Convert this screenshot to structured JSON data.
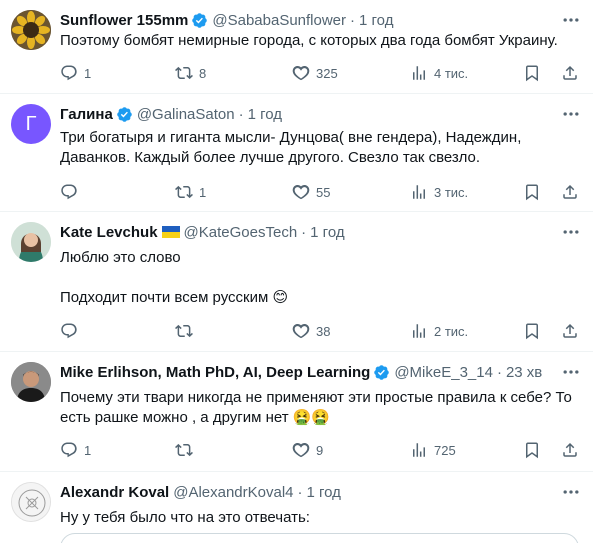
{
  "tweets": [
    {
      "name": "Sunflower 155mm",
      "verified": true,
      "handle": "@SababaSunflower",
      "time": "1 год",
      "text": [
        "Поэтому бомбят немирные города, с которых два года бомбят Украину."
      ],
      "replies": "1",
      "reposts": "8",
      "likes": "325",
      "views": "4 тис."
    },
    {
      "name": "Галина",
      "verified": true,
      "handle": "@GalinaSaton",
      "time": "1 год",
      "avatar_letter": "Г",
      "text": [
        "Три богатыря и гиганта мысли- Дунцова( вне гендера), Надеждин,",
        "Даванков. Каждый более лучше другого. Свезло так свезло."
      ],
      "replies": "",
      "reposts": "1",
      "likes": "55",
      "views": "3 тис."
    },
    {
      "name": "Kate Levchuk",
      "flag": "ukraine-flag",
      "handle": "@KateGoesTech",
      "time": "1 год",
      "text": [
        "Люблю это слово",
        "",
        "Подходит почти всем русским 😊"
      ],
      "replies": "",
      "reposts": "",
      "likes": "38",
      "views": "2 тис."
    },
    {
      "name": "Mike Erlihson, Math PhD, AI, Deep Learning",
      "verified": true,
      "handle": "@MikeE_3_14",
      "time": "23 хв",
      "text": [
        "Почему эти твари никогда не применяют эти простые правила к себе? То",
        "есть рашке можно , а другим нет 🤮🤮"
      ],
      "replies": "1",
      "reposts": "",
      "likes": "9",
      "views": "725"
    },
    {
      "name": "Alexandr Koval",
      "handle": "@AlexandrKoval4",
      "time": "1 год",
      "text": [
        "Ну у тебя было что на это отвечать:"
      ]
    }
  ],
  "separator": "·",
  "colors": {
    "verified": "#1d9bf0",
    "text": "#0f1419",
    "secondary": "#536471",
    "divider": "#eff3f4",
    "galina_avatar": "#7856ff"
  }
}
